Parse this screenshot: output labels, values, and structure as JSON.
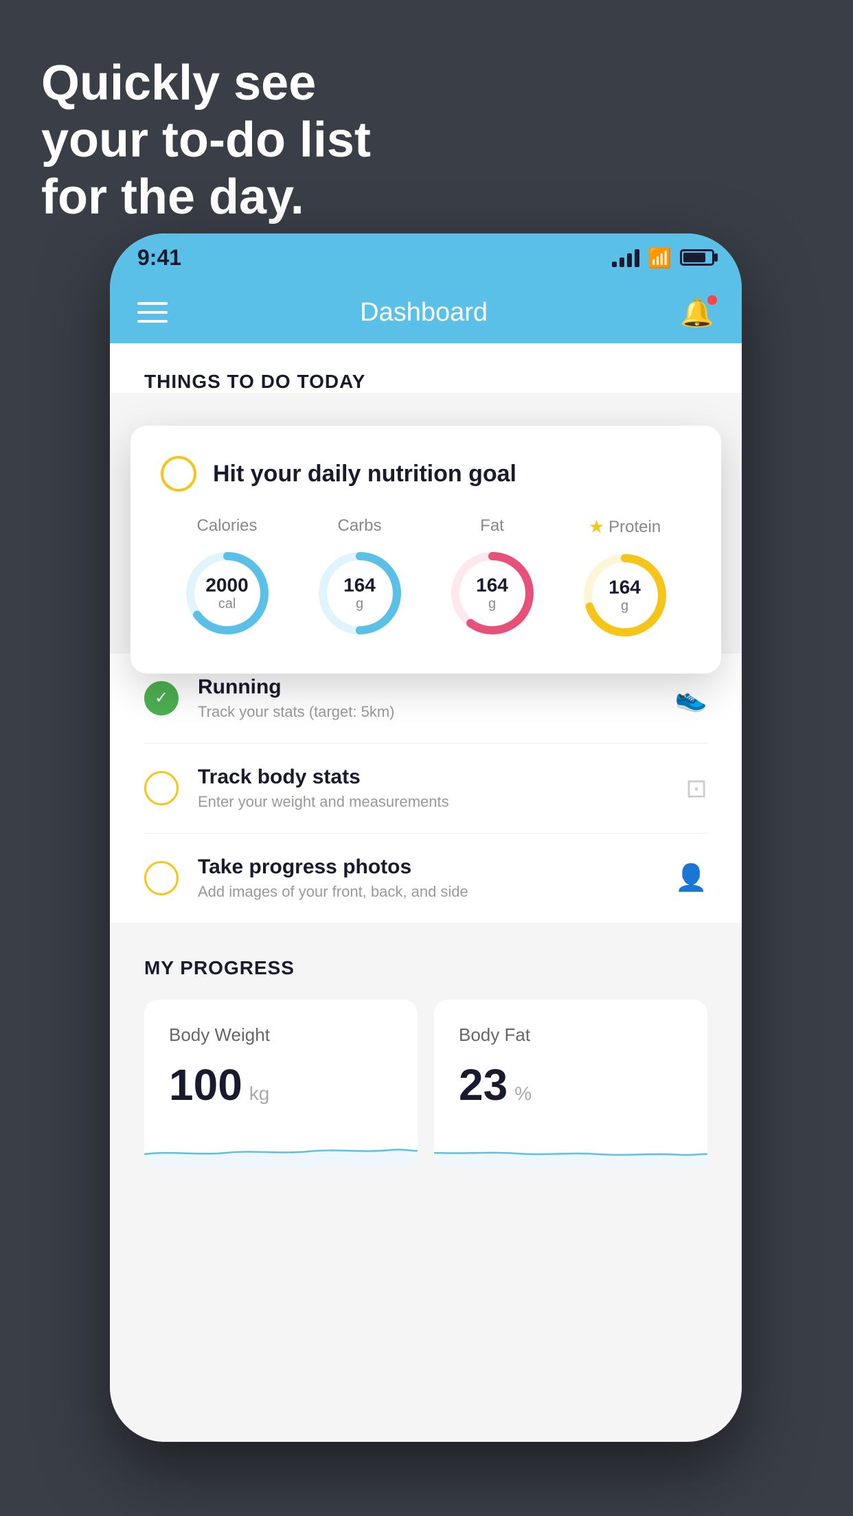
{
  "headline": {
    "line1": "Quickly see",
    "line2": "your to-do list",
    "line3": "for the day."
  },
  "status_bar": {
    "time": "9:41"
  },
  "app_header": {
    "title": "Dashboard"
  },
  "things_section": {
    "title": "THINGS TO DO TODAY"
  },
  "nutrition_card": {
    "title": "Hit your daily nutrition goal",
    "macros": [
      {
        "label": "Calories",
        "value": "2000",
        "unit": "cal",
        "color": "#5bc0e8",
        "track_color": "#e0f4fb",
        "pct": 65
      },
      {
        "label": "Carbs",
        "value": "164",
        "unit": "g",
        "color": "#5bc0e8",
        "track_color": "#e0f4fb",
        "pct": 50
      },
      {
        "label": "Fat",
        "value": "164",
        "unit": "g",
        "color": "#e8507a",
        "track_color": "#fde8ee",
        "pct": 60
      },
      {
        "label": "Protein",
        "value": "164",
        "unit": "g",
        "color": "#f5c518",
        "track_color": "#fdf5d8",
        "pct": 70,
        "starred": true
      }
    ]
  },
  "todo_items": [
    {
      "name": "Running",
      "desc": "Track your stats (target: 5km)",
      "circle": "green",
      "icon": "🥿"
    },
    {
      "name": "Track body stats",
      "desc": "Enter your weight and measurements",
      "circle": "yellow",
      "icon": "⚖"
    },
    {
      "name": "Take progress photos",
      "desc": "Add images of your front, back, and side",
      "circle": "yellow",
      "icon": "👤"
    }
  ],
  "progress_section": {
    "title": "MY PROGRESS",
    "cards": [
      {
        "label": "Body Weight",
        "value": "100",
        "unit": "kg"
      },
      {
        "label": "Body Fat",
        "value": "23",
        "unit": "%"
      }
    ]
  }
}
